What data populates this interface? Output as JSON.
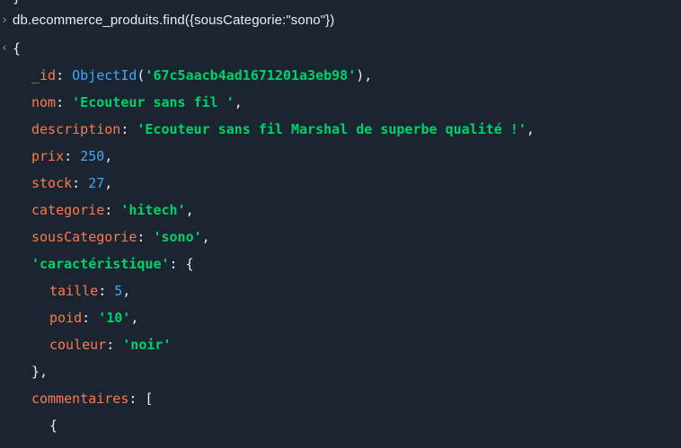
{
  "prompt": {
    "input_chevron": "›",
    "output_chevron": "‹",
    "command": "db.ecommerce_produits.find({sousCategorie:\"sono\"})"
  },
  "result": {
    "open_brace": "{",
    "fields": {
      "id_key": "_id",
      "id_fn": "ObjectId",
      "id_value": "'67c5aacb4ad1671201a3eb98'",
      "nom_key": "nom",
      "nom_value": "'Ecouteur sans fil '",
      "description_key": "description",
      "description_value": "'Ecouteur sans fil Marshal de superbe qualité !'",
      "prix_key": "prix",
      "prix_value": "250",
      "stock_key": "stock",
      "stock_value": "27",
      "categorie_key": "categorie",
      "categorie_value": "'hitech'",
      "souscategorie_key": "sousCategorie",
      "souscategorie_value": "'sono'",
      "caracteristique_key": "'caractéristique'",
      "taille_key": "taille",
      "taille_value": "5",
      "poid_key": "poid",
      "poid_value": "'10'",
      "couleur_key": "couleur",
      "couleur_value": "'noir'",
      "commentaires_key": "commentaires"
    }
  },
  "colors": {
    "background": "#1b2532",
    "key": "#ff7a45",
    "string": "#00d26a",
    "number": "#3fa9f5",
    "text": "#e6edf3"
  }
}
